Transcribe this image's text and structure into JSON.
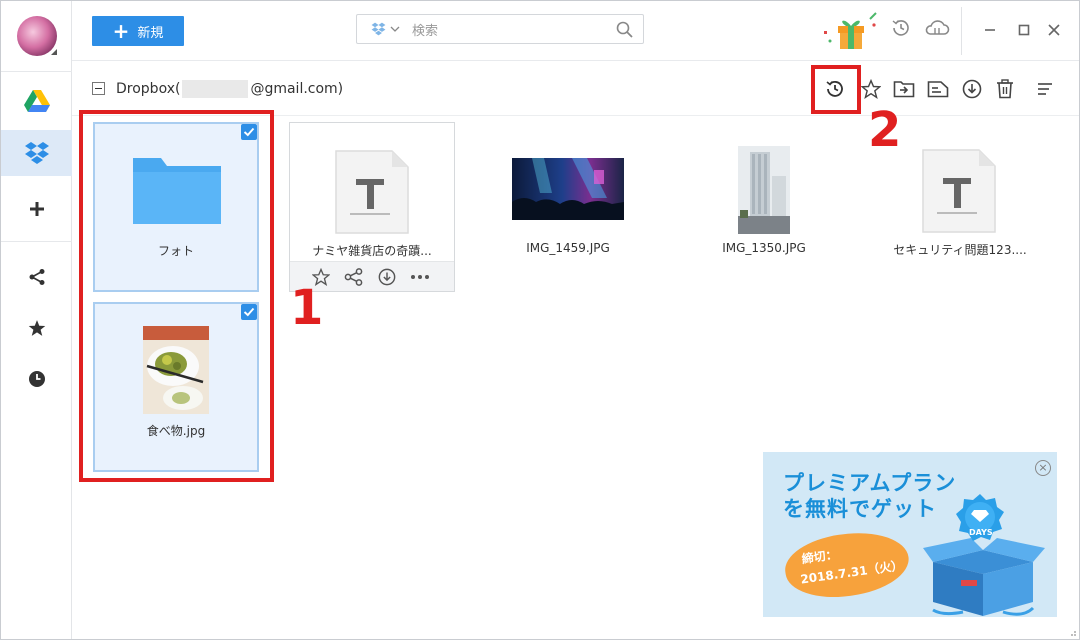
{
  "toolbar": {
    "new_label": "新規"
  },
  "search": {
    "placeholder": "検索"
  },
  "crumb": {
    "prefix": "Dropbox(",
    "suffix": "@gmail.com)"
  },
  "files": [
    {
      "name": "フォト",
      "type": "folder",
      "selected": true
    },
    {
      "name": "ナミヤ雑貨店の奇蹟...",
      "type": "text",
      "selected": false
    },
    {
      "name": "IMG_1459.JPG",
      "type": "image",
      "selected": false
    },
    {
      "name": "IMG_1350.JPG",
      "type": "image",
      "selected": false
    },
    {
      "name": "セキュリティ問題123....",
      "type": "text",
      "selected": false
    },
    {
      "name": "食べ物.jpg",
      "type": "image",
      "selected": true
    }
  ],
  "annotations": {
    "step1": "1",
    "step2": "2"
  },
  "promo": {
    "line1": "プレミアムプラン",
    "line2": "を無料でゲット",
    "deadline_label": "締切：",
    "deadline_date": "2018.7.31（火）",
    "badge": "DAYS"
  },
  "colors": {
    "accent": "#2d8ee6",
    "annotation_red": "#e02020",
    "selection_bg": "#e9f2fd",
    "promo_bg": "#d2e8f6"
  }
}
